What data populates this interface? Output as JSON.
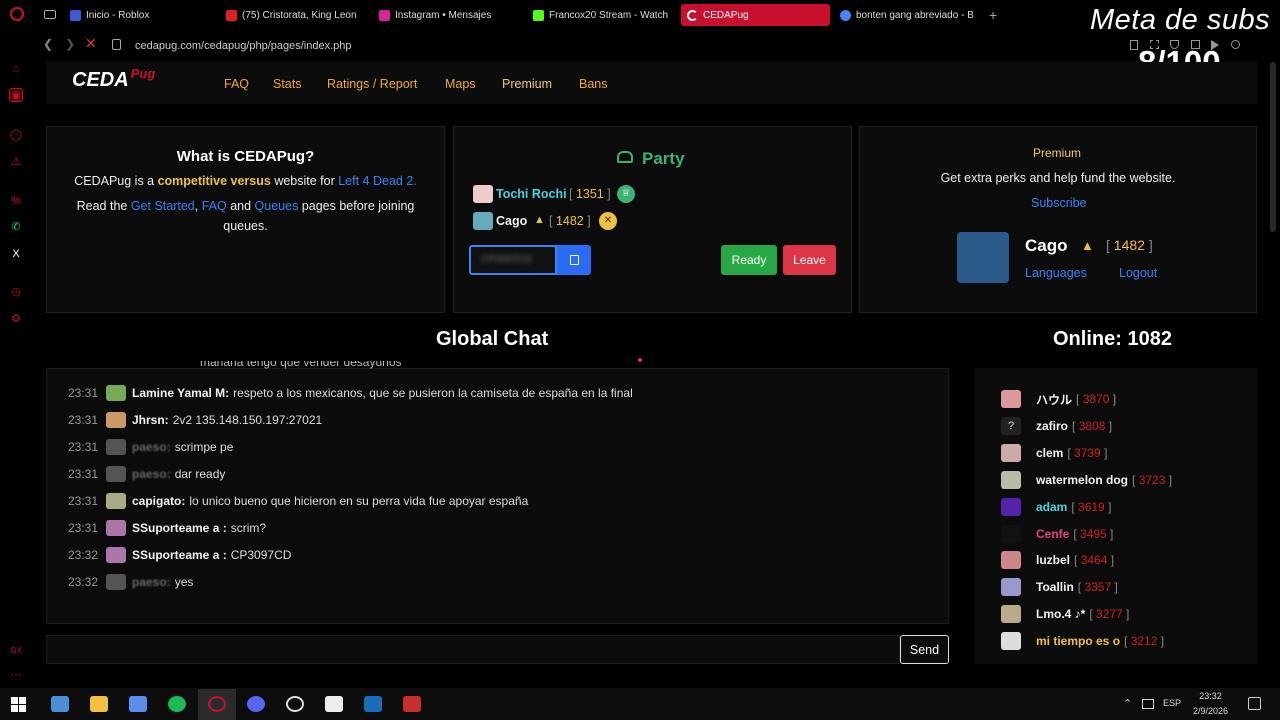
{
  "browser": {
    "tabs": [
      {
        "label": "Inicio - Roblox",
        "icon": "roblox-icon",
        "color": "#3b5bdb"
      },
      {
        "label": "(75) Cristorata, King Leon",
        "icon": "youtube-icon",
        "color": "#e02020"
      },
      {
        "label": "Instagram • Mensajes",
        "icon": "instagram-icon",
        "color": "#d6249f"
      },
      {
        "label": "Francox20 Stream - Watch",
        "icon": "kick-icon",
        "color": "#53fc18"
      },
      {
        "label": "CEDAPug",
        "icon": "loading-icon",
        "color": "#c8102e"
      },
      {
        "label": "bonten gang abreviado - B",
        "icon": "google-icon",
        "color": "#4285f4"
      }
    ],
    "new_tab": "+",
    "url": "cedapug.com/cedapug/php/pages/index.php",
    "overlay_title": "Meta de subs",
    "overlay_count": "8/100"
  },
  "nav": {
    "logo_main": "CEDA",
    "logo_sub": "Pug",
    "items": [
      "FAQ",
      "Stats",
      "Ratings / Report",
      "Maps",
      "Premium",
      "Bans"
    ]
  },
  "about": {
    "title": "What is CEDAPug?",
    "l1a": "CEDAPug is a ",
    "l1b": "competitive versus",
    "l1c": " website for ",
    "l1d": "Left 4 Dead 2.",
    "l2a": "Read the ",
    "l2b": "Get Started",
    "l2c": ", ",
    "l2d": "FAQ",
    "l2e": " and ",
    "l2f": "Queues",
    "l2g": " pages before joining",
    "l3": "queues."
  },
  "party": {
    "title": "Party",
    "members": [
      {
        "name": "Tochi Rochi",
        "rating": "1351",
        "badge": "crown-icon"
      },
      {
        "name": "Cago",
        "rating": "1482",
        "badge": "close-icon"
      }
    ],
    "code_placeholder": "CP3097CD",
    "ready": "Ready",
    "leave": "Leave"
  },
  "premium": {
    "title": "Premium",
    "text": "Get extra perks and help fund the website.",
    "subscribe": "Subscribe",
    "user": "Cago",
    "rating": "1482",
    "languages": "Languages",
    "logout": "Logout"
  },
  "chat": {
    "title": "Global Chat",
    "partial": "mañana tengo que vender desayunos",
    "messages": [
      {
        "time": "23:31",
        "user": "Lamine Yamal M:",
        "text": "respeto a los mexicanos, que se pusieron la camiseta de españa en la final",
        "av": "#7a5"
      },
      {
        "time": "23:31",
        "user": "Jhrsn:",
        "text": "2v2 135.148.150.197:27021",
        "av": "#c96"
      },
      {
        "time": "23:31",
        "user": "paeso:",
        "text": "scrimpe pe",
        "av": "#555",
        "blur": true
      },
      {
        "time": "23:31",
        "user": "paeso:",
        "text": "dar ready",
        "av": "#555",
        "blur": true
      },
      {
        "time": "23:31",
        "user": "capigato:",
        "text": "lo unico bueno que hicieron en su perra vida fue apoyar españa",
        "av": "#aa8"
      },
      {
        "time": "23:31",
        "user": "SSuporteame a :",
        "text": "scrim?",
        "av": "#a7a"
      },
      {
        "time": "23:32",
        "user": "SSuporteame a :",
        "text": "CP3097CD",
        "av": "#a7a"
      },
      {
        "time": "23:32",
        "user": "paeso:",
        "text": "yes",
        "av": "#555",
        "blur": true
      }
    ],
    "send": "Send"
  },
  "online": {
    "title": "Online: 1082",
    "users": [
      {
        "name": "ハウル",
        "rating": "3870",
        "color": "#f2f2f2",
        "av": "#d99"
      },
      {
        "name": "zafiro",
        "rating": "3808",
        "color": "#f2f2f2",
        "av": "#222"
      },
      {
        "name": "clem",
        "rating": "3739",
        "color": "#f2f2f2",
        "av": "#caa"
      },
      {
        "name": "watermelon dog",
        "rating": "3723",
        "color": "#f2f2f2",
        "av": "#bba"
      },
      {
        "name": "adam",
        "rating": "3619",
        "color": "#4dd0e1",
        "av": "#52a"
      },
      {
        "name": "Cenfe",
        "rating": "3495",
        "color": "#e0457b",
        "av": "#111"
      },
      {
        "name": "luzbel",
        "rating": "3464",
        "color": "#f2f2f2",
        "av": "#c88"
      },
      {
        "name": "Toallin",
        "rating": "3357",
        "color": "#f2f2f2",
        "av": "#99c"
      },
      {
        "name": "Lmo.4 ♪*",
        "rating": "3277",
        "color": "#f2f2f2",
        "av": "#ba8"
      },
      {
        "name": "mi tiempo es o",
        "rating": "3212",
        "color": "#f0c040",
        "av": "#ddd"
      }
    ],
    "unknown_avatar": "?"
  },
  "taskbar": {
    "lang": "ESP",
    "time": "23:32",
    "date": "2/9/2026"
  }
}
